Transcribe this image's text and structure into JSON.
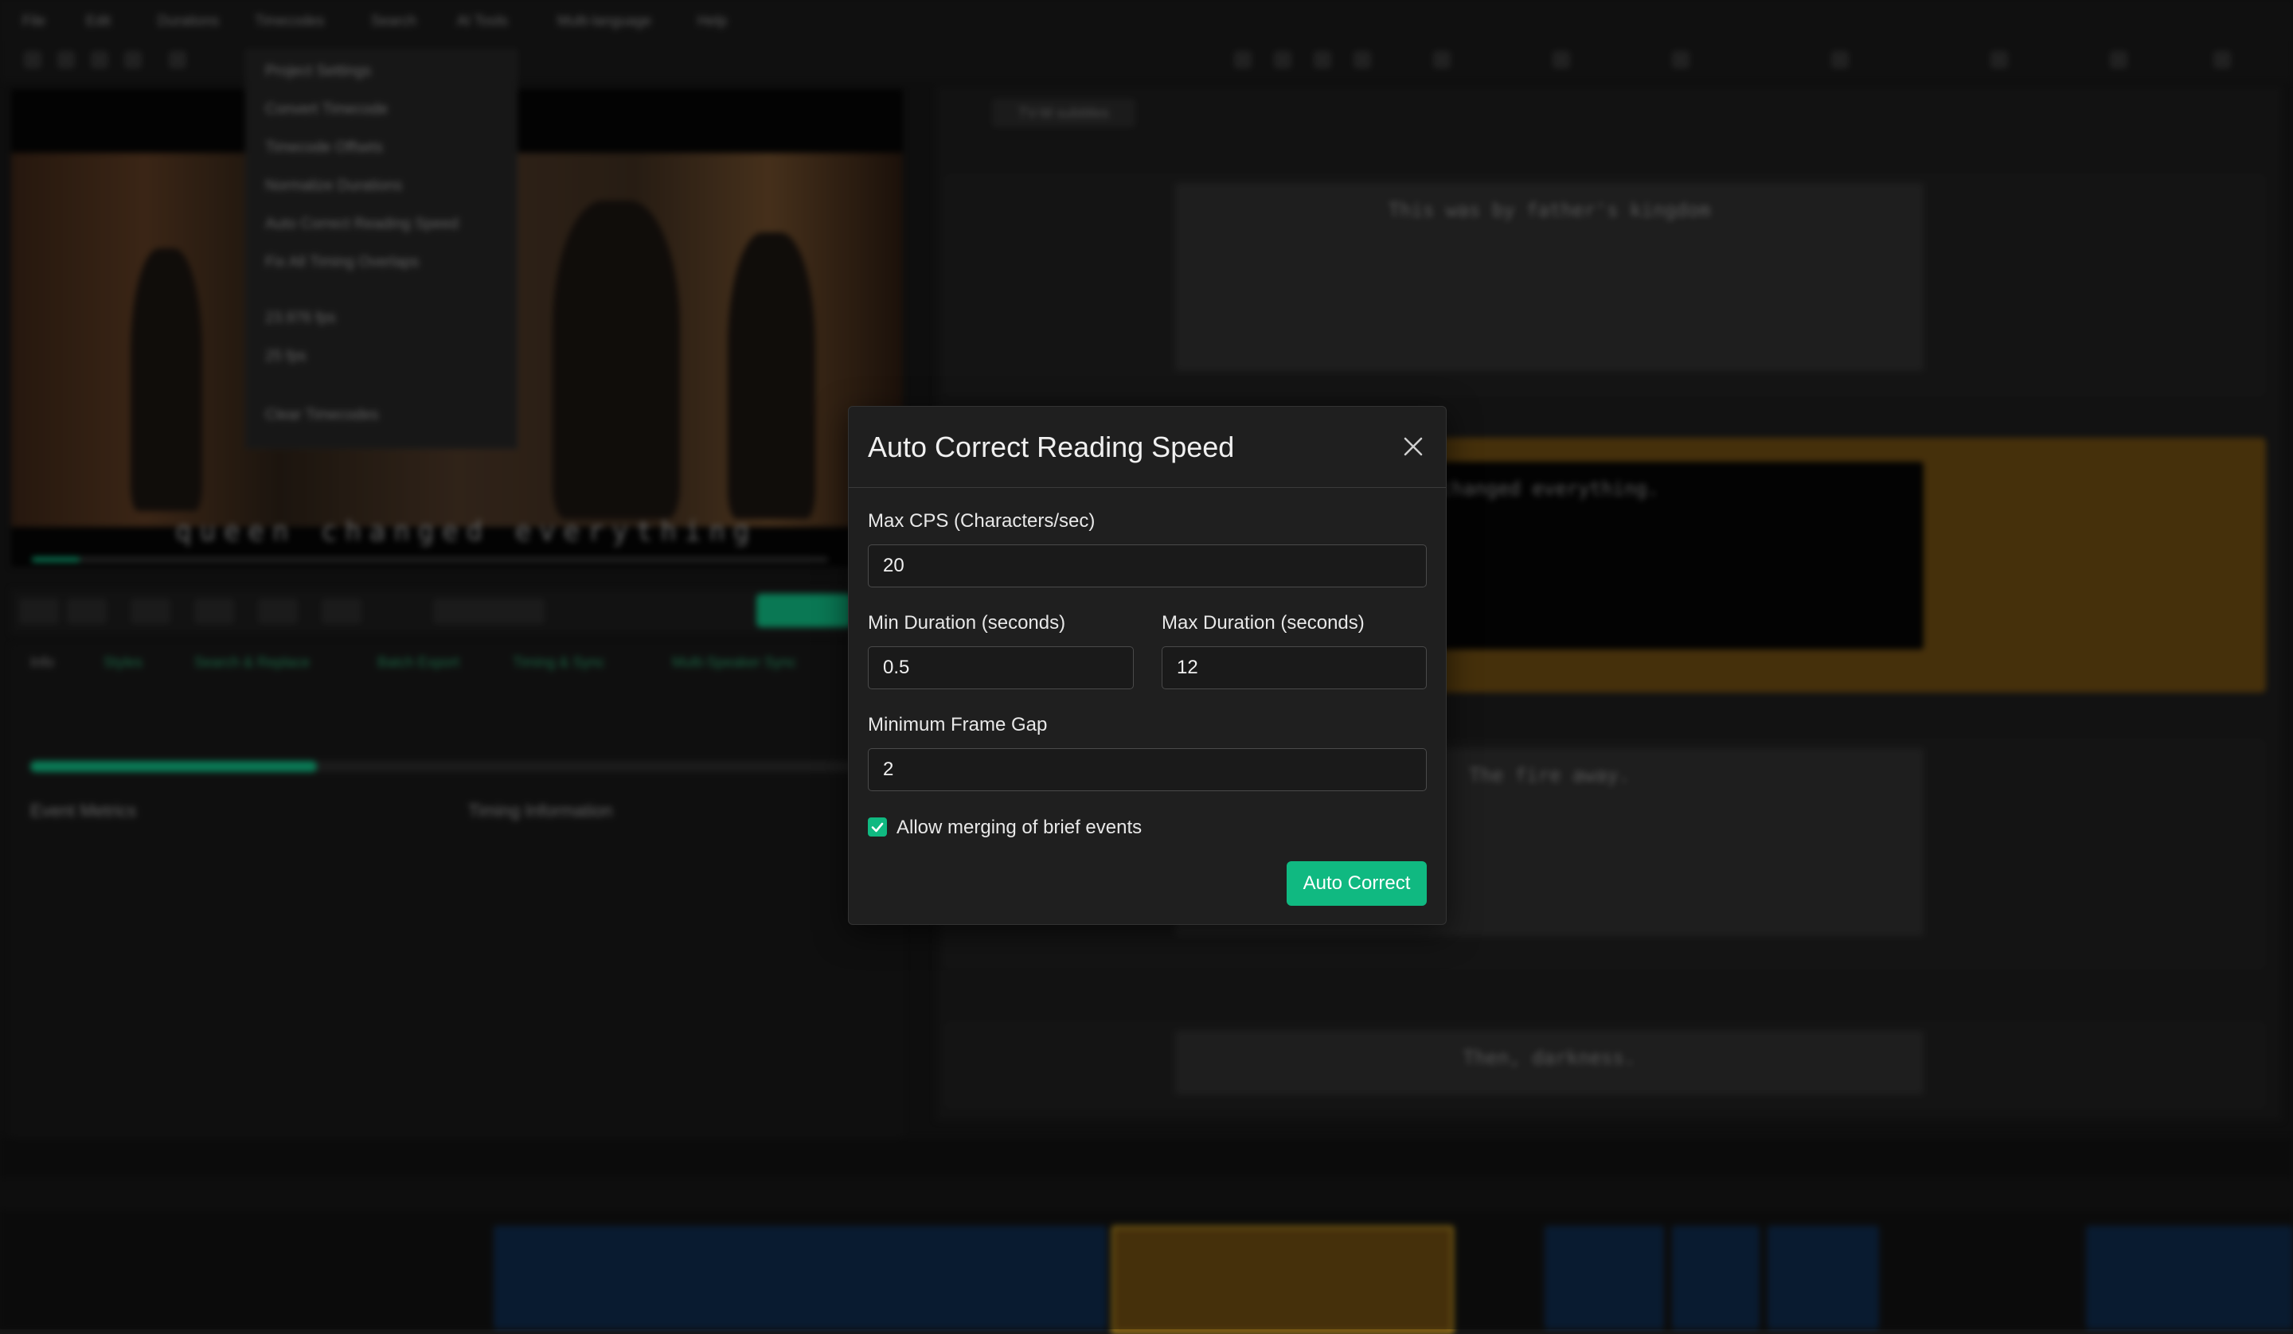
{
  "background": {
    "menu": [
      "File",
      "Edit",
      "Durations",
      "Timecodes",
      "Search",
      "AI Tools",
      "Multi-language",
      "Help"
    ],
    "context_menu": [
      "Project Settings",
      "Convert Timecode",
      "Timecode Offsets",
      "Normalize Durations",
      "Auto Correct Reading Speed",
      "Fix All Timing Overlaps",
      "23.976 fps",
      "25 fps",
      "Clear Timecodes"
    ],
    "video_subtitle": "queen changed everything",
    "lower_tabs": [
      "Info",
      "Styles",
      "Search & Replace",
      "Batch Export",
      "Timing & Sync",
      "Multi-Speaker Sync"
    ],
    "event_metrics_title": "Event Metrics",
    "timing_info_title": "Timing Information",
    "subtitle_tab": "TV-M subtitles",
    "event_texts": [
      "This was by father's kingdom",
      "changed everything.",
      "The fire away.",
      "Then, darkness."
    ],
    "colors": {
      "accent": "#10b981",
      "selected_event": "#6b4a12",
      "clip_blue": "#0f2a4a"
    }
  },
  "dialog": {
    "title": "Auto Correct Reading Speed",
    "close_icon": "close-icon",
    "max_cps": {
      "label": "Max CPS (Characters/sec)",
      "value": "20"
    },
    "min_duration": {
      "label": "Min Duration (seconds)",
      "value": "0.5"
    },
    "max_duration": {
      "label": "Max Duration (seconds)",
      "value": "12"
    },
    "min_frame_gap": {
      "label": "Minimum Frame Gap",
      "value": "2"
    },
    "allow_merge": {
      "label": "Allow merging of brief events",
      "checked": true
    },
    "submit_label": "Auto Correct"
  }
}
